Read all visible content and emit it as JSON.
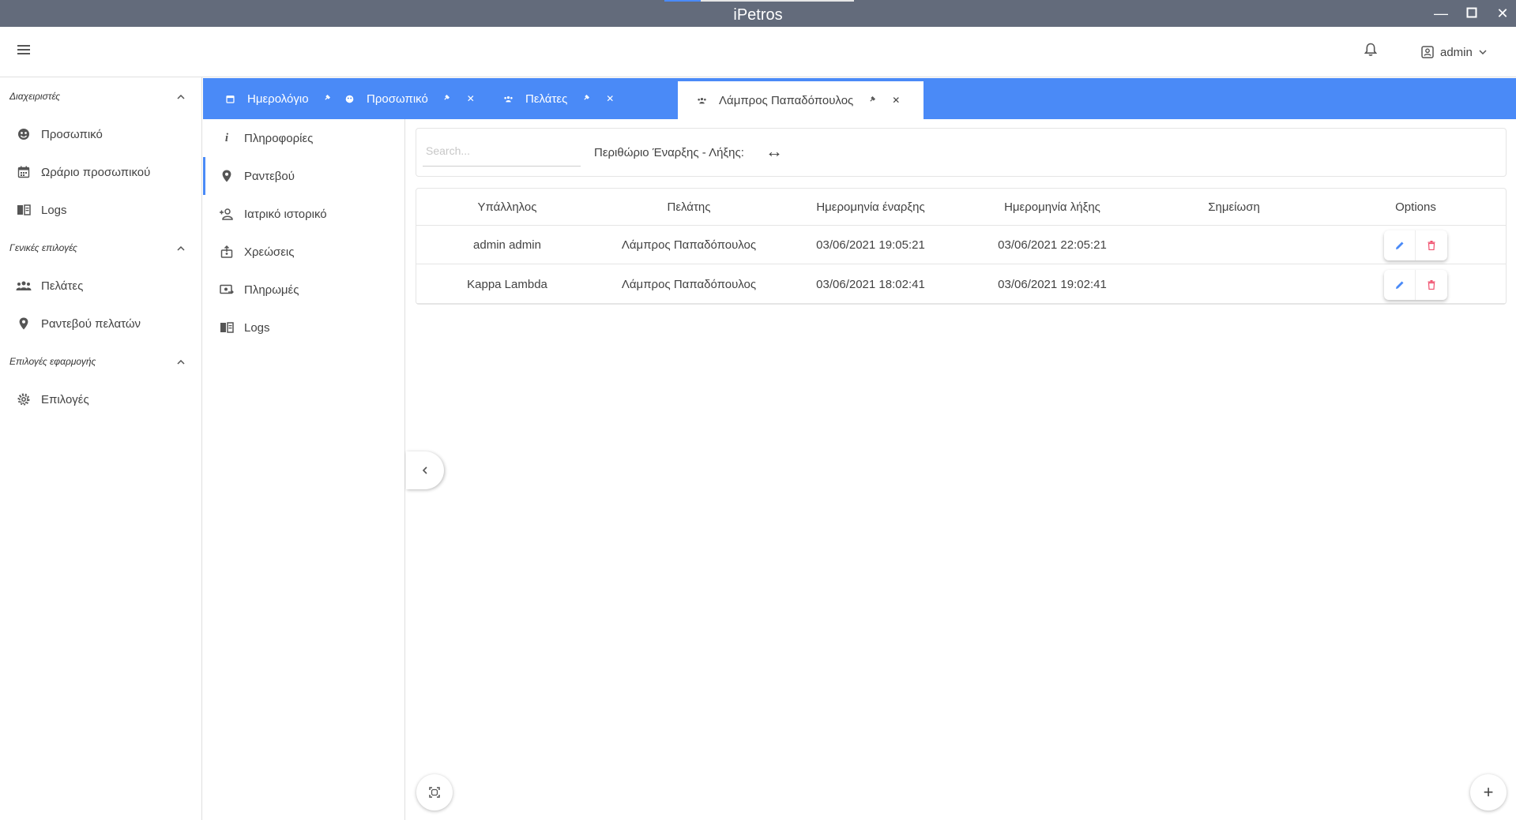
{
  "window": {
    "title": "iPetros",
    "min": "—",
    "max": "☐",
    "close": "✕"
  },
  "header": {
    "user": "admin"
  },
  "sidebar": {
    "sections": [
      {
        "title": "Διαχειριστές",
        "items": [
          {
            "label": "Προσωπικό",
            "icon": "staff-icon"
          },
          {
            "label": "Ωράριο προσωπικού",
            "icon": "calendar-icon"
          },
          {
            "label": "Logs",
            "icon": "book-icon"
          }
        ]
      },
      {
        "title": "Γενικές επιλογές",
        "items": [
          {
            "label": "Πελάτες",
            "icon": "people-icon"
          },
          {
            "label": "Ραντεβού πελατών",
            "icon": "map-pin-icon"
          }
        ]
      },
      {
        "title": "Επιλογές εφαρμογής",
        "items": [
          {
            "label": "Επιλογές",
            "icon": "gear-icon"
          }
        ]
      }
    ]
  },
  "tabs": [
    {
      "label": "Ημερολόγιο",
      "icon": "calendar-icon",
      "active": false
    },
    {
      "label": "Προσωπικό",
      "icon": "staff-icon",
      "active": false
    },
    {
      "label": "Πελάτες",
      "icon": "people-icon",
      "active": false
    },
    {
      "label": "Λάμπρος Παπαδόπουλος",
      "icon": "people-icon",
      "active": true
    }
  ],
  "subnav": [
    {
      "label": "Πληροφορίες",
      "icon": "info-icon"
    },
    {
      "label": "Ραντεβού",
      "icon": "map-pin-icon",
      "active": true
    },
    {
      "label": "Ιατρικό ιστορικό",
      "icon": "person-add-icon"
    },
    {
      "label": "Χρεώσεις",
      "icon": "charge-icon"
    },
    {
      "label": "Πληρωμές",
      "icon": "payment-icon"
    },
    {
      "label": "Logs",
      "icon": "book-icon"
    }
  ],
  "filter": {
    "search_placeholder": "Search...",
    "range_label": "Περιθώριο Έναρξης - Λήξης:",
    "range_value": "↔"
  },
  "table": {
    "columns": [
      "Υπάλληλος",
      "Πελάτης",
      "Ημερομηνία έναρξης",
      "Ημερομηνία λήξης",
      "Σημείωση",
      "Options"
    ],
    "rows": [
      {
        "employee": "admin admin",
        "client": "Λάμπρος Παπαδόπουλος",
        "start": "03/06/2021 19:05:21",
        "end": "03/06/2021 22:05:21",
        "note": ""
      },
      {
        "employee": "Kappa Lambda",
        "client": "Λάμπρος Παπαδόπουλος",
        "start": "03/06/2021 18:02:41",
        "end": "03/06/2021 19:02:41",
        "note": ""
      }
    ]
  },
  "colors": {
    "accent": "#4a8af7",
    "titlebar": "#636b7b",
    "delete": "#f0506e"
  },
  "fab": {
    "add": "+",
    "collapse": "‹"
  }
}
